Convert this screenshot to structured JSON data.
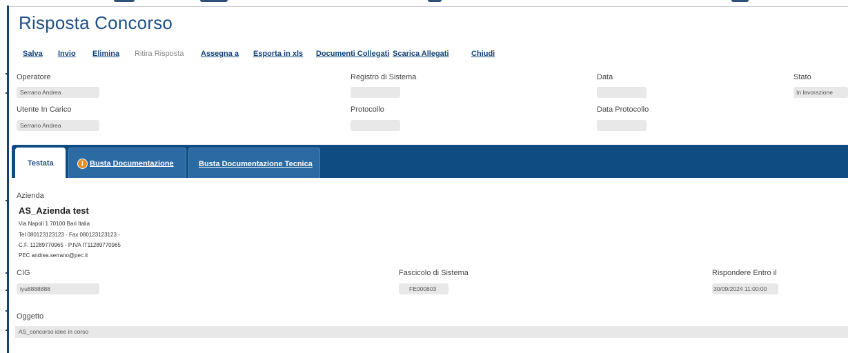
{
  "header": {
    "title": "Risposta Concorso"
  },
  "toolbar": {
    "salva": "Salva",
    "invio": "Invio",
    "elimina": "Elimina",
    "ritira": "Ritira Risposta",
    "assegna": "Assegna a",
    "esporta": "Esporta in xls",
    "documenti": "Documenti Collegati",
    "scarica": "Scarica Allegati",
    "chiudi": "Chiudi"
  },
  "info": {
    "operatore_label": "Operatore",
    "operatore_value": "Serrano Andrea",
    "registro_label": "Registro di Sistema",
    "registro_value": "",
    "data_label": "Data",
    "data_value": "",
    "stato_label": "Stato",
    "stato_value": "In lavorazione",
    "utente_label": "Utente In Carico",
    "utente_value": "Serrano Andrea",
    "protocollo_label": "Protocollo",
    "protocollo_value": "",
    "data_protocollo_label": "Data Protocollo",
    "data_protocollo_value": ""
  },
  "tabs": {
    "testata": "Testata",
    "busta_doc": "Busta Documentazione",
    "busta_tecnica": "Busta Documentazione Tecnica",
    "warning_glyph": "!"
  },
  "azienda": {
    "label": "Azienda",
    "name": "AS_Azienda test",
    "address": "Via Napoli 1 70100 Bari Italia",
    "phone": "Tel 080123123123 - Fax 080123123123 -",
    "fiscal": "C.F. 11289770965 - P.IVA IT11289770965",
    "pec": "PEC andrea.serrano@pec.it"
  },
  "details": {
    "cig_label": "CIG",
    "cig_value": "iyu8888888",
    "fascicolo_label": "Fascicolo di Sistema",
    "fascicolo_value": "FE000803",
    "rispondere_label": "Rispondere Entro il",
    "rispondere_value": "30/09/2024 11:00:00",
    "oggetto_label": "Oggetto",
    "oggetto_value": "AS_concorso idee in corso"
  },
  "colors": {
    "brand": "#0f4c81",
    "link": "#14427a",
    "warning": "#f08a1c"
  }
}
